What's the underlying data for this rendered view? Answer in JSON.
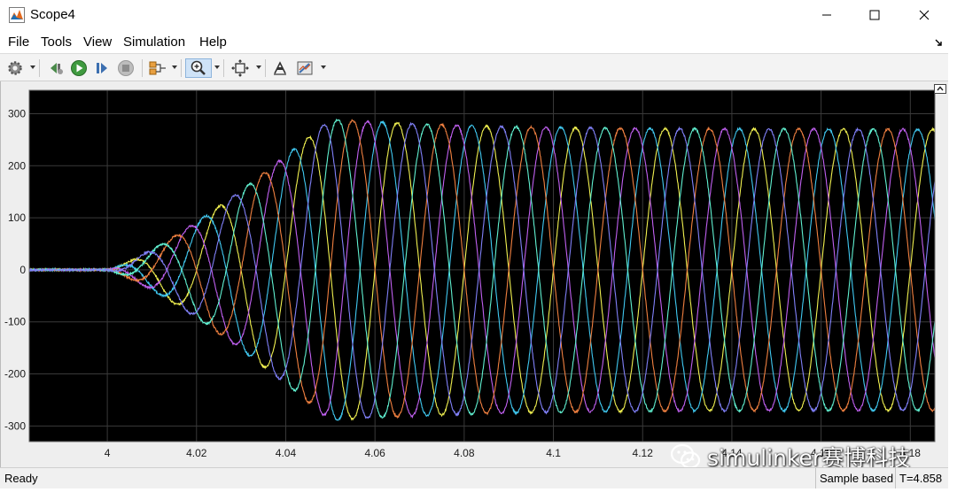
{
  "window": {
    "title": "Scope4"
  },
  "menu": [
    "File",
    "Tools",
    "View",
    "Simulation",
    "Help"
  ],
  "toolbar": {
    "icons": [
      "gear-icon",
      "step-back-icon",
      "run-icon",
      "step-forward-icon",
      "stop-icon",
      "highlight-block-icon",
      "zoom-icon",
      "autoscale-icon",
      "signal-select-icon",
      "style-icon"
    ]
  },
  "status": {
    "ready": "Ready",
    "mode": "Sample based",
    "time": "T=4.858"
  },
  "watermark": {
    "text": "simulinker赛博科技"
  },
  "colors": {
    "plot_bg": "#000000",
    "axes_bg": "#eeeeee",
    "grid": "#3a3a3a",
    "tick_text": "#1a1a1a",
    "series": [
      "#f0f050",
      "#40c8f0",
      "#c060f0",
      "#f08040",
      "#60f0d0",
      "#8080f8"
    ]
  },
  "chart_data": {
    "type": "line",
    "xlim": [
      3.9825,
      4.1855
    ],
    "ylim": [
      -330,
      345
    ],
    "xticks": [
      4,
      4.02,
      4.04,
      4.06,
      4.08,
      4.1,
      4.12,
      4.14,
      4.16,
      4.18
    ],
    "xtick_labels": [
      "4",
      "4.02",
      "4.04",
      "4.06",
      "4.08",
      "4.1",
      "4.12",
      "4.14",
      "4.16",
      "4.18"
    ],
    "yticks": [
      300,
      200,
      100,
      0,
      -100,
      -200,
      -300
    ],
    "ytick_labels": [
      "300",
      "200",
      "100",
      "0",
      "-100",
      "-200",
      "-300"
    ],
    "grid": true,
    "signal": {
      "frequency_hz": 50,
      "onset_time": 4.0,
      "peak_time": 4.05,
      "peak_amplitude": 290,
      "steady_amplitude": 270
    },
    "series": [
      {
        "phase_deg": 0
      },
      {
        "phase_deg": 60
      },
      {
        "phase_deg": 120
      },
      {
        "phase_deg": 180
      },
      {
        "phase_deg": 240
      },
      {
        "phase_deg": 300
      }
    ]
  }
}
